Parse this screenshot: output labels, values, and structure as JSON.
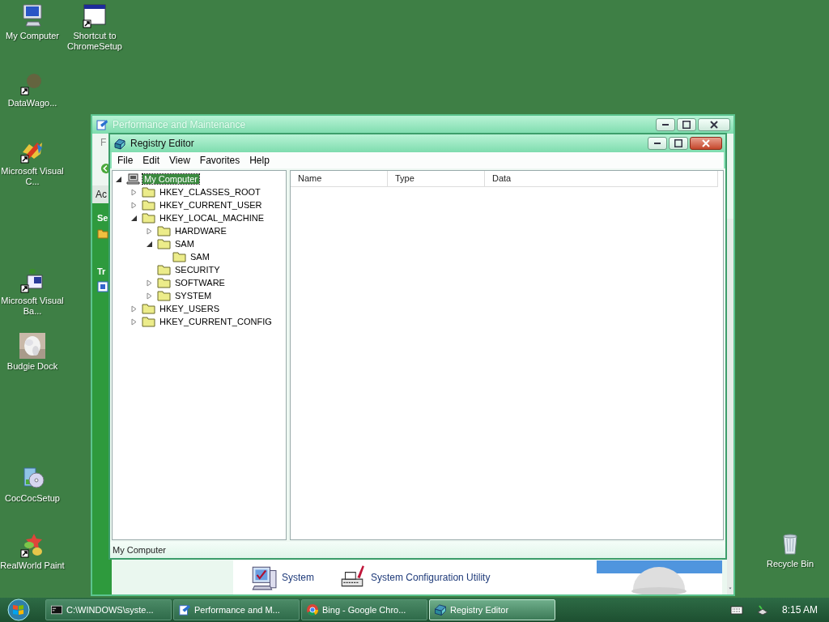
{
  "desktop_icons": [
    {
      "label": "My Computer",
      "kind": "computer"
    },
    {
      "label": "Shortcut to ChromeSetup",
      "kind": "window"
    },
    {
      "label": "DataWago...",
      "kind": "faint"
    },
    {
      "label": "Microsoft Visual C...",
      "kind": "ribbon"
    },
    {
      "label": "Microsoft Visual Ba...",
      "kind": "vb"
    },
    {
      "label": "Budgie Dock",
      "kind": "picture"
    },
    {
      "label": "CocCocSetup",
      "kind": "installer"
    },
    {
      "label": "RealWorld Paint",
      "kind": "paint"
    },
    {
      "label": "Recycle Bin",
      "kind": "bin"
    }
  ],
  "back_window": {
    "title": "Performance and Maintenance",
    "menu_fragment": "F",
    "address_fragment": "Ac",
    "panel_headings": [
      "Se",
      "Tr"
    ],
    "items": [
      {
        "label": "System",
        "kind": "computer"
      },
      {
        "label": "System Configuration Utility",
        "kind": "printer"
      }
    ]
  },
  "registry_window": {
    "title": "Registry Editor",
    "menu": [
      "File",
      "Edit",
      "View",
      "Favorites",
      "Help"
    ],
    "tree": [
      {
        "label": "My Computer",
        "kind": "computer",
        "selected": true,
        "expanded": true,
        "children": [
          {
            "label": "HKEY_CLASSES_ROOT",
            "selected": false,
            "expanded": false
          },
          {
            "label": "HKEY_CURRENT_USER",
            "selected": false,
            "expanded": false
          },
          {
            "label": "HKEY_LOCAL_MACHINE",
            "selected": false,
            "expanded": true,
            "children": [
              {
                "label": "HARDWARE",
                "selected": false,
                "expanded": false
              },
              {
                "label": "SAM",
                "selected": false,
                "expanded": true,
                "children": [
                  {
                    "label": "SAM",
                    "selected": false
                  }
                ]
              },
              {
                "label": "SECURITY",
                "selected": false
              },
              {
                "label": "SOFTWARE",
                "selected": false,
                "expanded": false
              },
              {
                "label": "SYSTEM",
                "selected": false,
                "expanded": false
              }
            ]
          },
          {
            "label": "HKEY_USERS",
            "selected": false,
            "expanded": false
          },
          {
            "label": "HKEY_CURRENT_CONFIG",
            "selected": false,
            "expanded": false
          }
        ]
      }
    ],
    "columns": [
      "Name",
      "Type",
      "Data"
    ],
    "status_bar": "My Computer"
  },
  "taskbar": {
    "tasks": [
      {
        "label": "C:\\WINDOWS\\syste...",
        "kind": "console",
        "selected": false
      },
      {
        "label": "Performance and M...",
        "kind": "control",
        "selected": false
      },
      {
        "label": "Bing - Google Chro...",
        "kind": "chrome",
        "selected": false
      },
      {
        "label": "Registry Editor",
        "kind": "regedit",
        "selected": true
      }
    ],
    "clock": "8:15 AM"
  }
}
